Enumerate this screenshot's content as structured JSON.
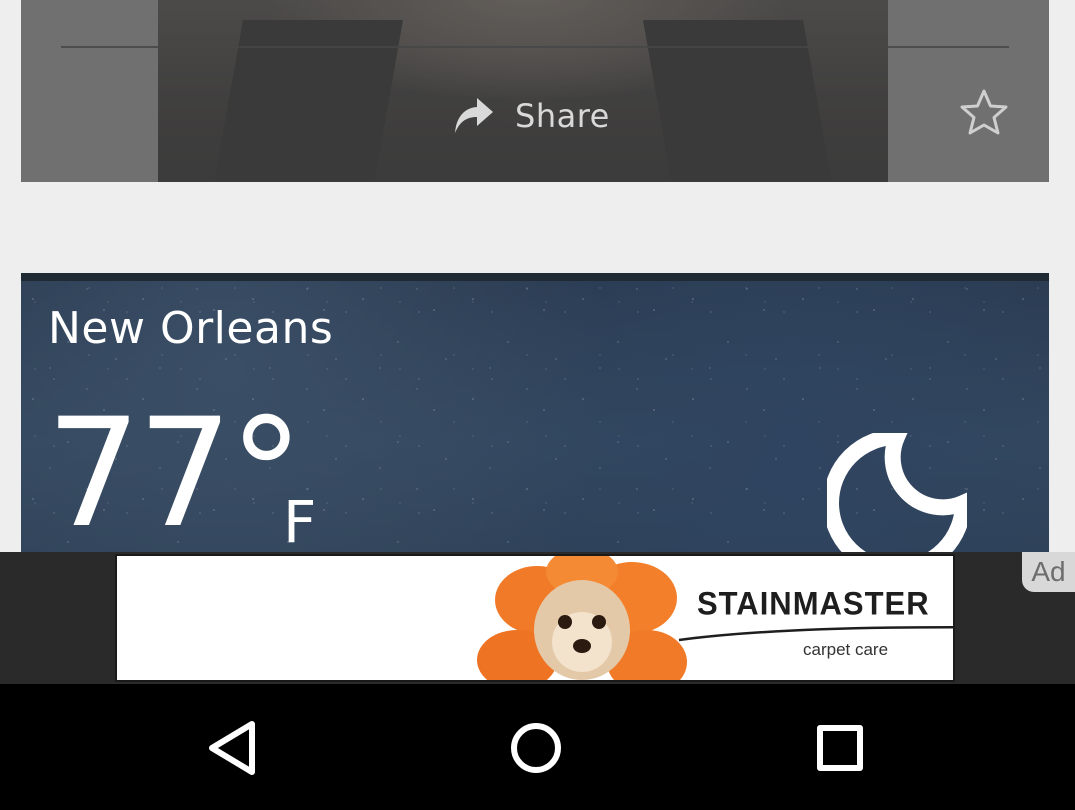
{
  "news_card": {
    "share_label": "Share",
    "share_icon": "share-arrow-icon",
    "favorite_icon": "star-outline-icon"
  },
  "weather_card": {
    "city": "New Orleans",
    "temperature": "77°",
    "unit": "F",
    "condition_icon": "crescent-moon-icon"
  },
  "ad": {
    "badge": "Ad",
    "brand": "STAINMASTER",
    "tagline": "carpet care"
  },
  "nav_bar": {
    "back_icon": "back-triangle-icon",
    "home_icon": "home-circle-icon",
    "recents_icon": "recents-square-icon"
  },
  "colors": {
    "card_overlay": "#6e6e6e",
    "night_sky": "#34485f",
    "ad_background": "#2a2a2a",
    "nav_background": "#000000"
  }
}
